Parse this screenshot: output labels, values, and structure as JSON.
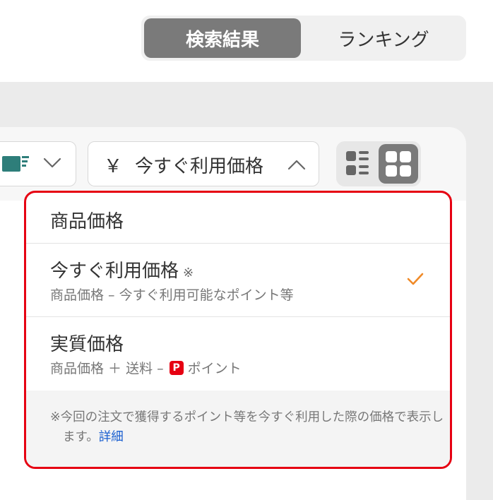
{
  "tabs": [
    {
      "label": "検索結果",
      "active": true
    },
    {
      "label": "ランキング",
      "active": false
    }
  ],
  "toolbar": {
    "yen_symbol": "￥",
    "sort_label": "今すぐ利用価格"
  },
  "dropdown": {
    "options": [
      {
        "title": "商品価格"
      },
      {
        "title": "今すぐ利用価格",
        "mark": "※",
        "subtitle": "商品価格 – 今すぐ利用可能なポイント等",
        "selected": true
      },
      {
        "title": "実質価格",
        "subtitle_prefix": "商品価格 ＋ 送料 –",
        "subtitle_badge": "P",
        "subtitle_suffix": "ポイント"
      }
    ],
    "note": {
      "text": "※今回の注文で獲得するポイント等を今すぐ利用した際の価格で表示します。",
      "link": "詳細"
    }
  },
  "colors": {
    "accent_red": "#e60012",
    "check_orange": "#f08a28",
    "link_blue": "#1a5fd0",
    "truck_teal": "#2e7e7a",
    "toggle_active": "#7a7a7a"
  }
}
